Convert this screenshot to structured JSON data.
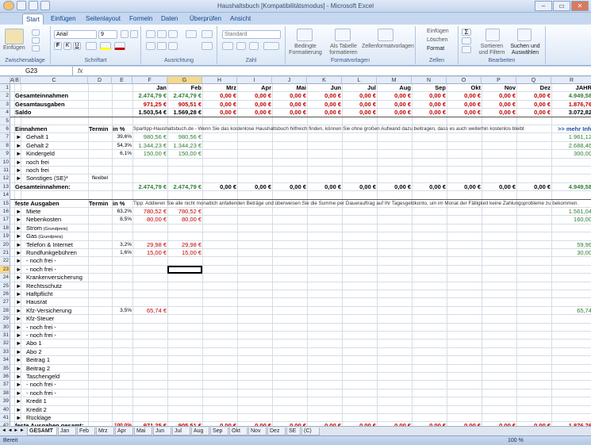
{
  "window": {
    "title": "Haushaltsbuch  [Kompatibilitätsmodus] - Microsoft Excel"
  },
  "ribbon": {
    "tabs": [
      "Start",
      "Einfügen",
      "Seitenlayout",
      "Formeln",
      "Daten",
      "Überprüfen",
      "Ansicht"
    ],
    "active_tab": "Start",
    "clipboard": {
      "paste": "Einfügen",
      "label": "Zwischenablage"
    },
    "font": {
      "name": "Arial",
      "size": "9",
      "label": "Schriftart"
    },
    "alignment": {
      "label": "Ausrichtung"
    },
    "number": {
      "format": "Standard",
      "label": "Zahl"
    },
    "styles": {
      "cond": "Bedingte Formatierung",
      "table": "Als Tabelle formatieren",
      "cell": "Zellenformatvorlagen",
      "label": "Formatvorlagen"
    },
    "cells": {
      "insert": "Einfügen",
      "delete": "Löschen",
      "format": "Format",
      "label": "Zellen"
    },
    "editing": {
      "sort": "Sortieren und Filtern",
      "find": "Suchen und Auswählen",
      "label": "Bearbeiten"
    }
  },
  "formula_bar": {
    "cell_ref": "G23",
    "fx": "fx",
    "value": ""
  },
  "columns": [
    "A",
    "B",
    "C",
    "D",
    "E",
    "F",
    "G",
    "H",
    "I",
    "J",
    "K",
    "L",
    "M",
    "N",
    "O",
    "P",
    "Q",
    "R"
  ],
  "months": [
    "Jan",
    "Feb",
    "Mrz",
    "Apr",
    "Mai",
    "Jun",
    "Jul",
    "Aug",
    "Sep",
    "Okt",
    "Nov",
    "Dez",
    "JAHR"
  ],
  "summary": [
    {
      "label": "Gesamteinnahmen",
      "values": [
        "2.474,79 €",
        "2.474,79 €",
        "0,00 €",
        "0,00 €",
        "0,00 €",
        "0,00 €",
        "0,00 €",
        "0,00 €",
        "0,00 €",
        "0,00 €",
        "0,00 €",
        "0,00 €",
        "4.949,58"
      ]
    },
    {
      "label": "Gesamtausgaben",
      "values": [
        "971,25 €",
        "905,51 €",
        "0,00 €",
        "0,00 €",
        "0,00 €",
        "0,00 €",
        "0,00 €",
        "0,00 €",
        "0,00 €",
        "0,00 €",
        "0,00 €",
        "0,00 €",
        "1.876,76"
      ]
    },
    {
      "label": "Saldo",
      "values": [
        "1.503,54 €",
        "1.569,28 €",
        "0,00 €",
        "0,00 €",
        "0,00 €",
        "0,00 €",
        "0,00 €",
        "0,00 €",
        "0,00 €",
        "0,00 €",
        "0,00 €",
        "0,00 €",
        "3.072,82"
      ]
    }
  ],
  "income": {
    "header": "Einnahmen",
    "termin": "Termin",
    "pct": "in %",
    "tip": "Spartipp-Haushaltsbuch.de - Wenn Sie das kostenlose Haushaltsbuch hilfreich finden, können Sie ohne großen Aufwand dazu beitragen, dass es auch weiterhin kostenlos bleibt",
    "more": ">> mehr Info",
    "rows": [
      {
        "label": "Gehalt 1",
        "termin": "",
        "pct": "39,6%",
        "jan": "980,56 €",
        "feb": "980,56 €",
        "year": "1.961,12"
      },
      {
        "label": "Gehalt 2",
        "termin": "",
        "pct": "54,3%",
        "jan": "1.344,23 €",
        "feb": "1.344,23 €",
        "year": "2.688,46"
      },
      {
        "label": "Kindergeld",
        "termin": "",
        "pct": "6,1%",
        "jan": "150,00 €",
        "feb": "150,00 €",
        "year": "300,00"
      },
      {
        "label": "noch frei",
        "termin": "",
        "pct": "",
        "jan": "",
        "feb": "",
        "year": ""
      },
      {
        "label": "noch frei",
        "termin": "",
        "pct": "",
        "jan": "",
        "feb": "",
        "year": ""
      },
      {
        "label": "Sonstiges (SE)*",
        "termin": "flexibel",
        "pct": "",
        "jan": "",
        "feb": "",
        "year": ""
      }
    ],
    "total_label": "Gesamteinnahmen:",
    "total": [
      "2.474,79 €",
      "2.474,79 €",
      "0,00 €",
      "0,00 €",
      "0,00 €",
      "0,00 €",
      "0,00 €",
      "0,00 €",
      "0,00 €",
      "0,00 €",
      "0,00 €",
      "0,00 €",
      "4.949,58"
    ]
  },
  "expenses": {
    "header": "feste Ausgaben",
    "termin": "Termin",
    "pct": "in %",
    "tip": "Tipp: Addieren Sie alle nicht monatlich anfallenden Beträge und überweisen Sie die Summe per Dauerauftrag auf Ihr Tagesgeldkonto, um im Monat der Fälligkeit keine Zahlungsprobleme zu bekommen.",
    "rows": [
      {
        "label": "Miete",
        "sub": "",
        "pct": "63,2%",
        "jan": "780,52 €",
        "feb": "780,52 €",
        "year": "1.561,04"
      },
      {
        "label": "Nebenkosten",
        "sub": "",
        "pct": "8,5%",
        "jan": "80,00 €",
        "feb": "80,00 €",
        "year": "160,00"
      },
      {
        "label": "Strom",
        "sub": "(Grundpreis)",
        "pct": "",
        "jan": "",
        "feb": "",
        "year": ""
      },
      {
        "label": "Gas",
        "sub": "(Grundpreis)",
        "pct": "",
        "jan": "",
        "feb": "",
        "year": ""
      },
      {
        "label": "Telefon & Internet",
        "sub": "",
        "pct": "3,2%",
        "jan": "29,98 €",
        "feb": "29,98 €",
        "year": "59,96"
      },
      {
        "label": "Rundfunkgebühren",
        "sub": "",
        "pct": "1,6%",
        "jan": "15,00 €",
        "feb": "15,00 €",
        "year": "30,00"
      },
      {
        "label": "- noch frei -",
        "sub": "",
        "pct": "",
        "jan": "",
        "feb": "",
        "year": ""
      },
      {
        "label": "- noch frei -",
        "sub": "",
        "pct": "",
        "jan": "",
        "feb": "",
        "year": ""
      },
      {
        "label": "Krankenversicherung",
        "sub": "",
        "pct": "",
        "jan": "",
        "feb": "",
        "year": ""
      },
      {
        "label": "Rechtsschutz",
        "sub": "",
        "pct": "",
        "jan": "",
        "feb": "",
        "year": ""
      },
      {
        "label": "Haftpflicht",
        "sub": "",
        "pct": "",
        "jan": "",
        "feb": "",
        "year": ""
      },
      {
        "label": "Hausrat",
        "sub": "",
        "pct": "",
        "jan": "",
        "feb": "",
        "year": ""
      },
      {
        "label": "Kfz-Versicherung",
        "sub": "",
        "pct": "3,5%",
        "jan": "65,74 €",
        "feb": "",
        "year": "65,74"
      },
      {
        "label": "Kfz-Steuer",
        "sub": "",
        "pct": "",
        "jan": "",
        "feb": "",
        "year": ""
      },
      {
        "label": "- noch frei -",
        "sub": "",
        "pct": "",
        "jan": "",
        "feb": "",
        "year": ""
      },
      {
        "label": "- noch frei -",
        "sub": "",
        "pct": "",
        "jan": "",
        "feb": "",
        "year": ""
      },
      {
        "label": "Abo 1",
        "sub": "",
        "pct": "",
        "jan": "",
        "feb": "",
        "year": ""
      },
      {
        "label": "Abo 2",
        "sub": "",
        "pct": "",
        "jan": "",
        "feb": "",
        "year": ""
      },
      {
        "label": "Beitrag 1",
        "sub": "",
        "pct": "",
        "jan": "",
        "feb": "",
        "year": ""
      },
      {
        "label": "Beitrag 2",
        "sub": "",
        "pct": "",
        "jan": "",
        "feb": "",
        "year": ""
      },
      {
        "label": "Taschengeld",
        "sub": "",
        "pct": "",
        "jan": "",
        "feb": "",
        "year": ""
      },
      {
        "label": "- noch frei -",
        "sub": "",
        "pct": "",
        "jan": "",
        "feb": "",
        "year": ""
      },
      {
        "label": "- noch frei -",
        "sub": "",
        "pct": "",
        "jan": "",
        "feb": "",
        "year": ""
      },
      {
        "label": "Kredit 1",
        "sub": "",
        "pct": "",
        "jan": "",
        "feb": "",
        "year": ""
      },
      {
        "label": "Kredit 2",
        "sub": "",
        "pct": "",
        "jan": "",
        "feb": "",
        "year": ""
      },
      {
        "label": "Rücklage",
        "sub": "",
        "pct": "",
        "jan": "",
        "feb": "",
        "year": ""
      }
    ],
    "total_label": "feste Ausgaben gesamt:",
    "total_pct": "100,0%",
    "total": [
      "971,25 €",
      "905,51 €",
      "0,00 €",
      "0,00 €",
      "0,00 €",
      "0,00 €",
      "0,00 €",
      "0,00 €",
      "0,00 €",
      "0,00 €",
      "0,00 €",
      "0,00 €",
      "1.876,76"
    ]
  },
  "row_numbers": [
    "1",
    "2",
    "3",
    "4",
    "5",
    "6",
    "7",
    "8",
    "9",
    "10",
    "11",
    "12",
    "13",
    "14",
    "15",
    "16",
    "17",
    "18",
    "19",
    "20",
    "21",
    "22",
    "23",
    "24",
    "25",
    "26",
    "27",
    "28",
    "29",
    "30",
    "31",
    "32",
    "33",
    "34",
    "35",
    "36",
    "37",
    "38",
    "39",
    "40",
    "41",
    "42"
  ],
  "sheets": [
    "GESAMT",
    "Jan",
    "Feb",
    "Mrz",
    "Apr",
    "Mai",
    "Jun",
    "Jul",
    "Aug",
    "Sep",
    "Okt",
    "Nov",
    "Dez",
    "SE",
    "(C)"
  ],
  "active_sheet": "GESAMT",
  "status": {
    "mode": "Bereit",
    "zoom": "100 %"
  },
  "colors": {
    "red": "#c00000",
    "green": "#2e7d32",
    "selected_header": "#f8d88a"
  }
}
